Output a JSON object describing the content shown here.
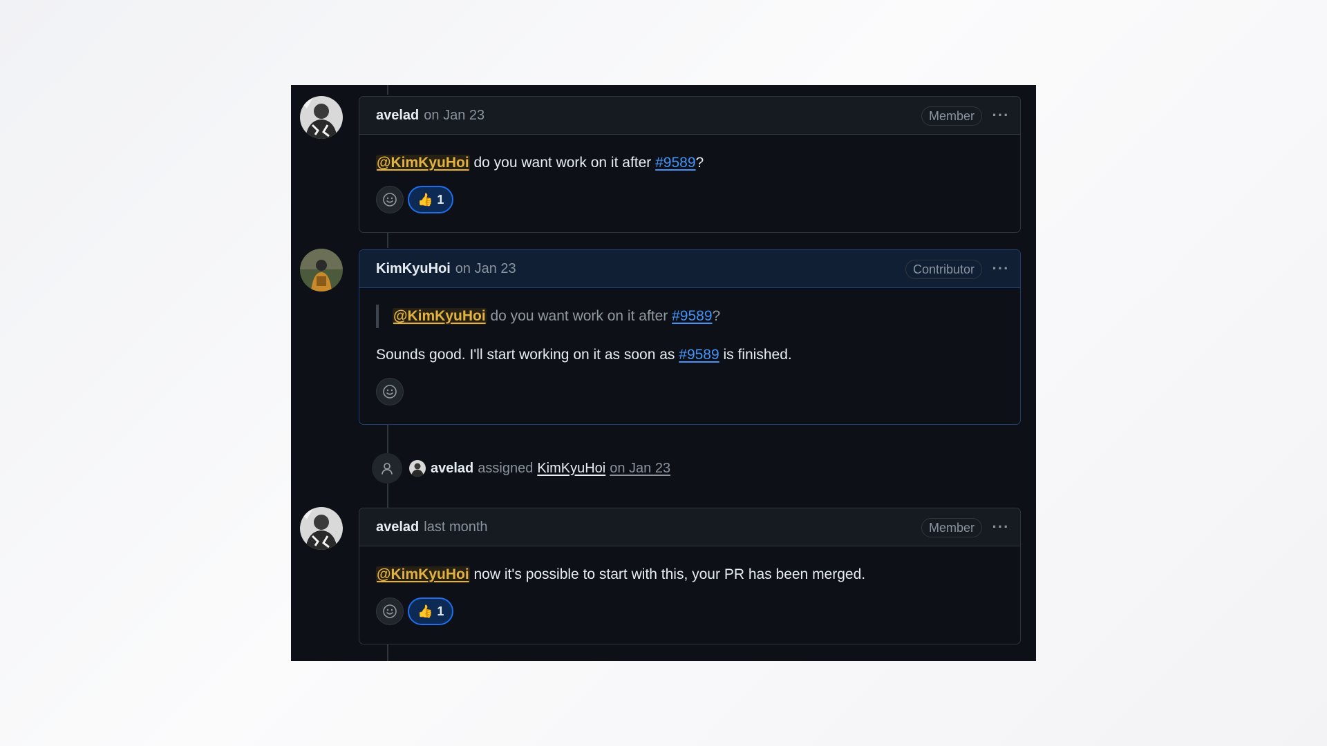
{
  "timeline": {
    "comments": [
      {
        "author": "avelad",
        "date": "on Jan 23",
        "role": "Member",
        "body": {
          "mention": "@KimKyuHoi",
          "text_before_link": " do you want work on it after ",
          "link": "#9589",
          "text_after_link": "?"
        },
        "reaction": {
          "emoji": "👍",
          "count": "1"
        }
      },
      {
        "author": "KimKyuHoi",
        "date": "on Jan 23",
        "role": "Contributor",
        "quote": {
          "mention": "@KimKyuHoi",
          "text_before_link": " do you want work on it after ",
          "link": "#9589",
          "text_after_link": "?"
        },
        "body": {
          "text_before_link": "Sounds good. I'll start working on it as soon as ",
          "link": "#9589",
          "text_after_link": " is finished."
        }
      },
      {
        "author": "avelad",
        "date": "last month",
        "role": "Member",
        "body": {
          "mention": "@KimKyuHoi",
          "text": " now it's possible to start with this, your PR has been merged."
        },
        "reaction": {
          "emoji": "👍",
          "count": "1"
        }
      }
    ],
    "assign_event": {
      "actor": "avelad",
      "verb": "assigned",
      "assignee": "KimKyuHoi",
      "date": "on Jan 23"
    }
  },
  "kebab_glyph": "···",
  "icons": {
    "kebab": "kebab-horizontal-icon",
    "add_reaction": "smiley-icon",
    "assign": "person-icon"
  },
  "colors": {
    "background": "#0d1117",
    "mention": "#e3b341",
    "link": "#4493f8",
    "reaction_accent": "#1f6feb"
  }
}
